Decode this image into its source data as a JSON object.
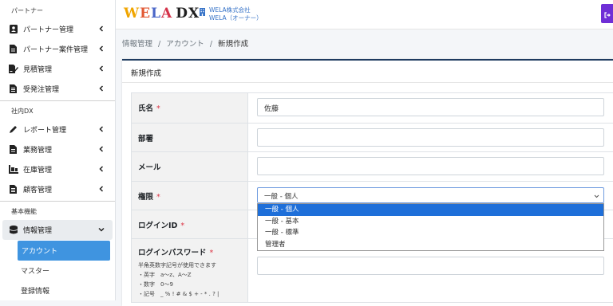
{
  "sidebar": {
    "sections": [
      {
        "label": "パートナー",
        "items": [
          {
            "label": "パートナー管理"
          },
          {
            "label": "パートナー案件管理"
          },
          {
            "label": "見積管理"
          },
          {
            "label": "受発注管理"
          }
        ]
      },
      {
        "label": "社内DX",
        "items": [
          {
            "label": "レポート管理"
          },
          {
            "label": "業務管理"
          },
          {
            "label": "在庫管理"
          },
          {
            "label": "顧客管理"
          }
        ]
      },
      {
        "label": "基本機能",
        "items": [
          {
            "label": "情報管理"
          }
        ]
      }
    ],
    "sub_items": [
      {
        "label": "アカウント"
      },
      {
        "label": "マスター"
      },
      {
        "label": "登録情報"
      }
    ]
  },
  "header": {
    "logo_letters": [
      "W",
      "E",
      "L",
      "A"
    ],
    "logo_suffix": "DX",
    "company": "WELA株式会社",
    "role": "WELA（オーナー）"
  },
  "breadcrumb": {
    "items": [
      "情報管理",
      "アカウント",
      "新規作成"
    ],
    "separator": "/"
  },
  "card": {
    "title": "新規作成"
  },
  "form": {
    "required_mark": "*",
    "name": {
      "label": "氏名",
      "value": "佐藤"
    },
    "department": {
      "label": "部署",
      "value": ""
    },
    "email": {
      "label": "メール",
      "value": ""
    },
    "permission": {
      "label": "権限",
      "selected": "一般 - 個人",
      "options": [
        "一般 - 個人",
        "一般 - 基本",
        "一般 - 標準",
        "管理者"
      ]
    },
    "login_id": {
      "label": "ログインID"
    },
    "password": {
      "label": "ログインパスワード",
      "help": [
        "半角英数字記号が使用できます",
        "・英字　a〜z、A〜Z",
        "・数字　0〜9",
        "・記号　_ % ! # & $ + - * . ? |"
      ]
    }
  },
  "colors": {
    "accent": "#3f94e0",
    "card_border": "#1f3b60",
    "logout": "#6f2fd6",
    "required": "#dc3545"
  }
}
